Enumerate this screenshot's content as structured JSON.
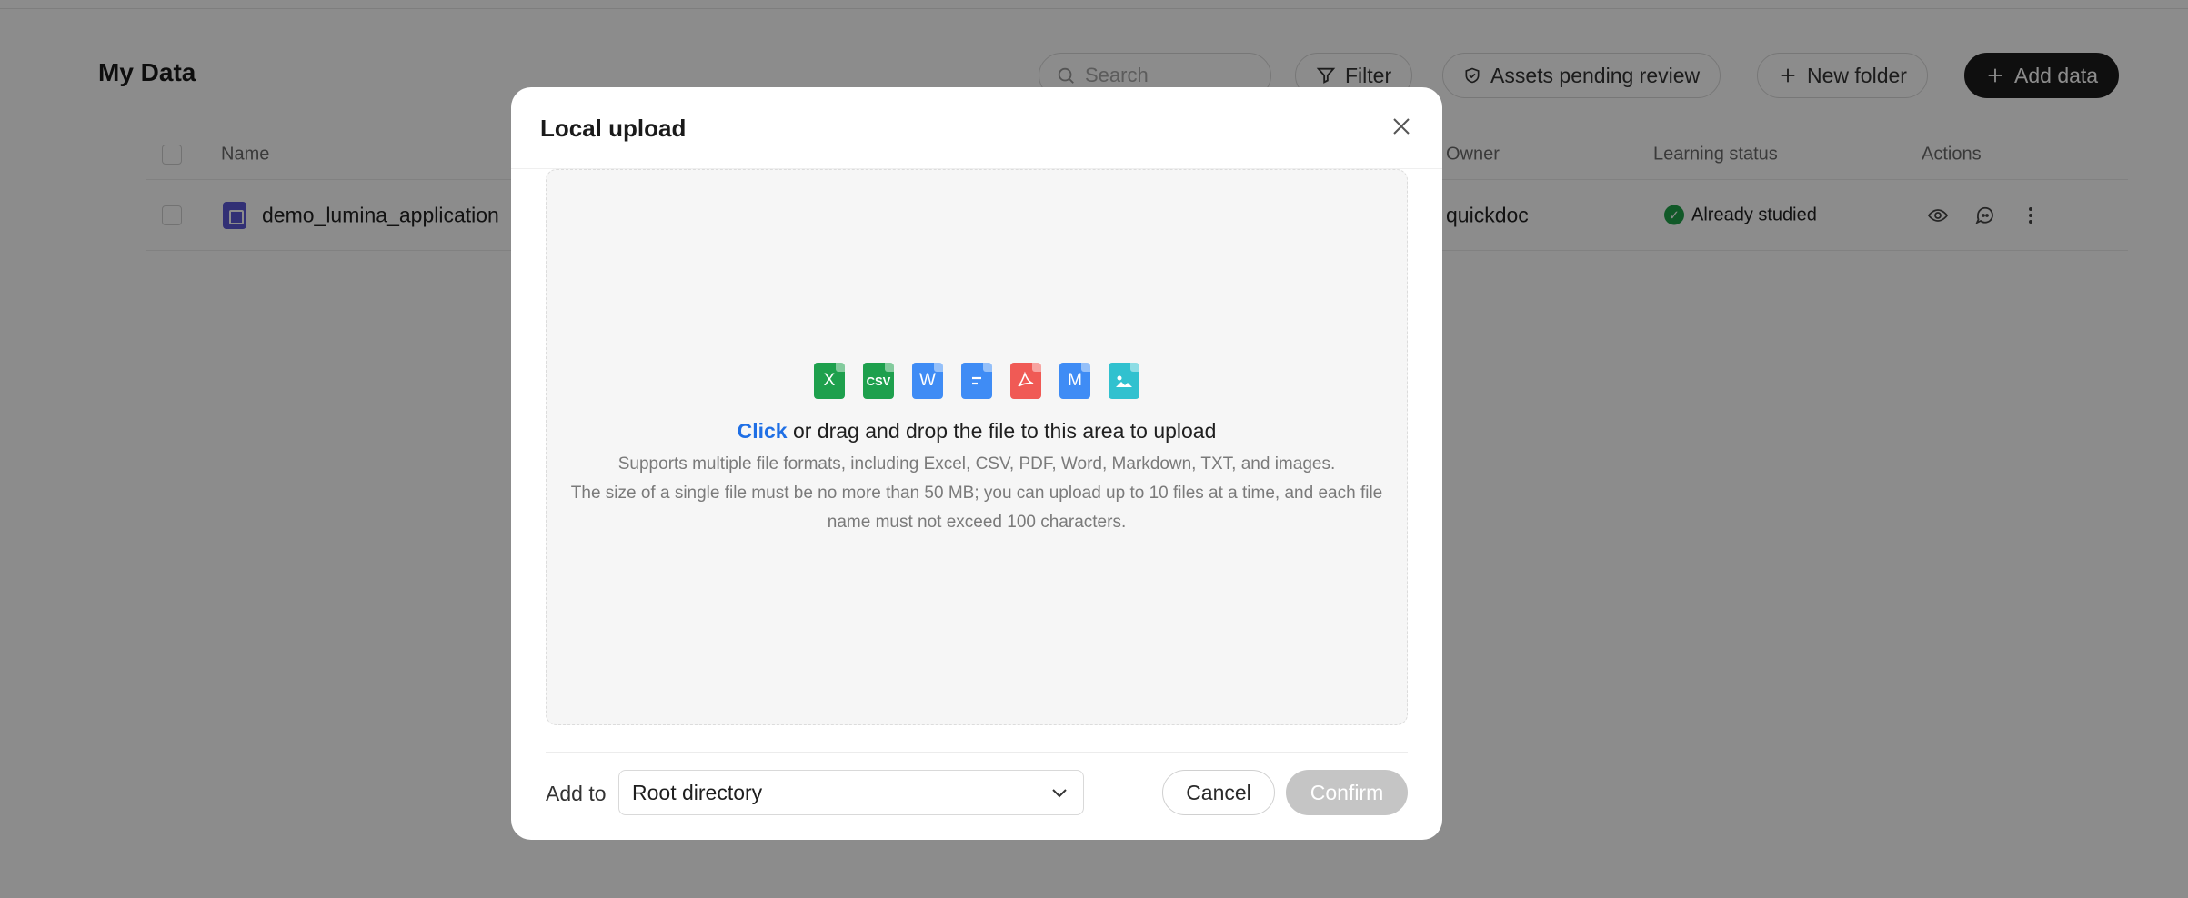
{
  "page": {
    "title": "My Data",
    "search_placeholder": "Search",
    "filter_label": "Filter",
    "pending_label": "Assets pending review",
    "new_folder_label": "New folder",
    "add_data_label": "Add data"
  },
  "table": {
    "columns": {
      "name": "Name",
      "owner": "Owner",
      "learning_status": "Learning status",
      "actions": "Actions"
    },
    "rows": [
      {
        "name": "demo_lumina_application",
        "owner": "quickdoc",
        "status": "Already studied"
      }
    ]
  },
  "modal": {
    "title": "Local upload",
    "format_icons": [
      {
        "icon": "excel-icon",
        "text": "X",
        "color": "#1ea04d"
      },
      {
        "icon": "csv-icon",
        "text": "CSV",
        "color": "#1ea04d"
      },
      {
        "icon": "word-icon",
        "text": "W",
        "color": "#3f8cf5"
      },
      {
        "icon": "txt-icon",
        "text": "",
        "color": "#3f8cf5"
      },
      {
        "icon": "pdf-icon",
        "text": "",
        "color": "#f05a55"
      },
      {
        "icon": "markdown-icon",
        "text": "M",
        "color": "#3f8cf5"
      },
      {
        "icon": "image-icon",
        "text": "",
        "color": "#31c1cf"
      }
    ],
    "upload_click": "Click",
    "upload_rest": " or drag and drop the file to this area to upload",
    "formats_note": "Supports multiple file formats, including Excel, CSV, PDF, Word, Markdown, TXT, and images.",
    "size_note_1": "The size of a single file must be no more than 50 MB; you can upload up to 10 files at a time, and each file",
    "size_note_2": "name must not exceed 100 characters.",
    "add_to_label": "Add to",
    "add_to_value": "Root directory",
    "cancel_label": "Cancel",
    "confirm_label": "Confirm"
  },
  "colors": {
    "accent": "#1f6fe5",
    "primary_dark": "#1d1d1d",
    "success": "#1fa34a",
    "overlay": "rgba(0,0,0,0.45)"
  }
}
